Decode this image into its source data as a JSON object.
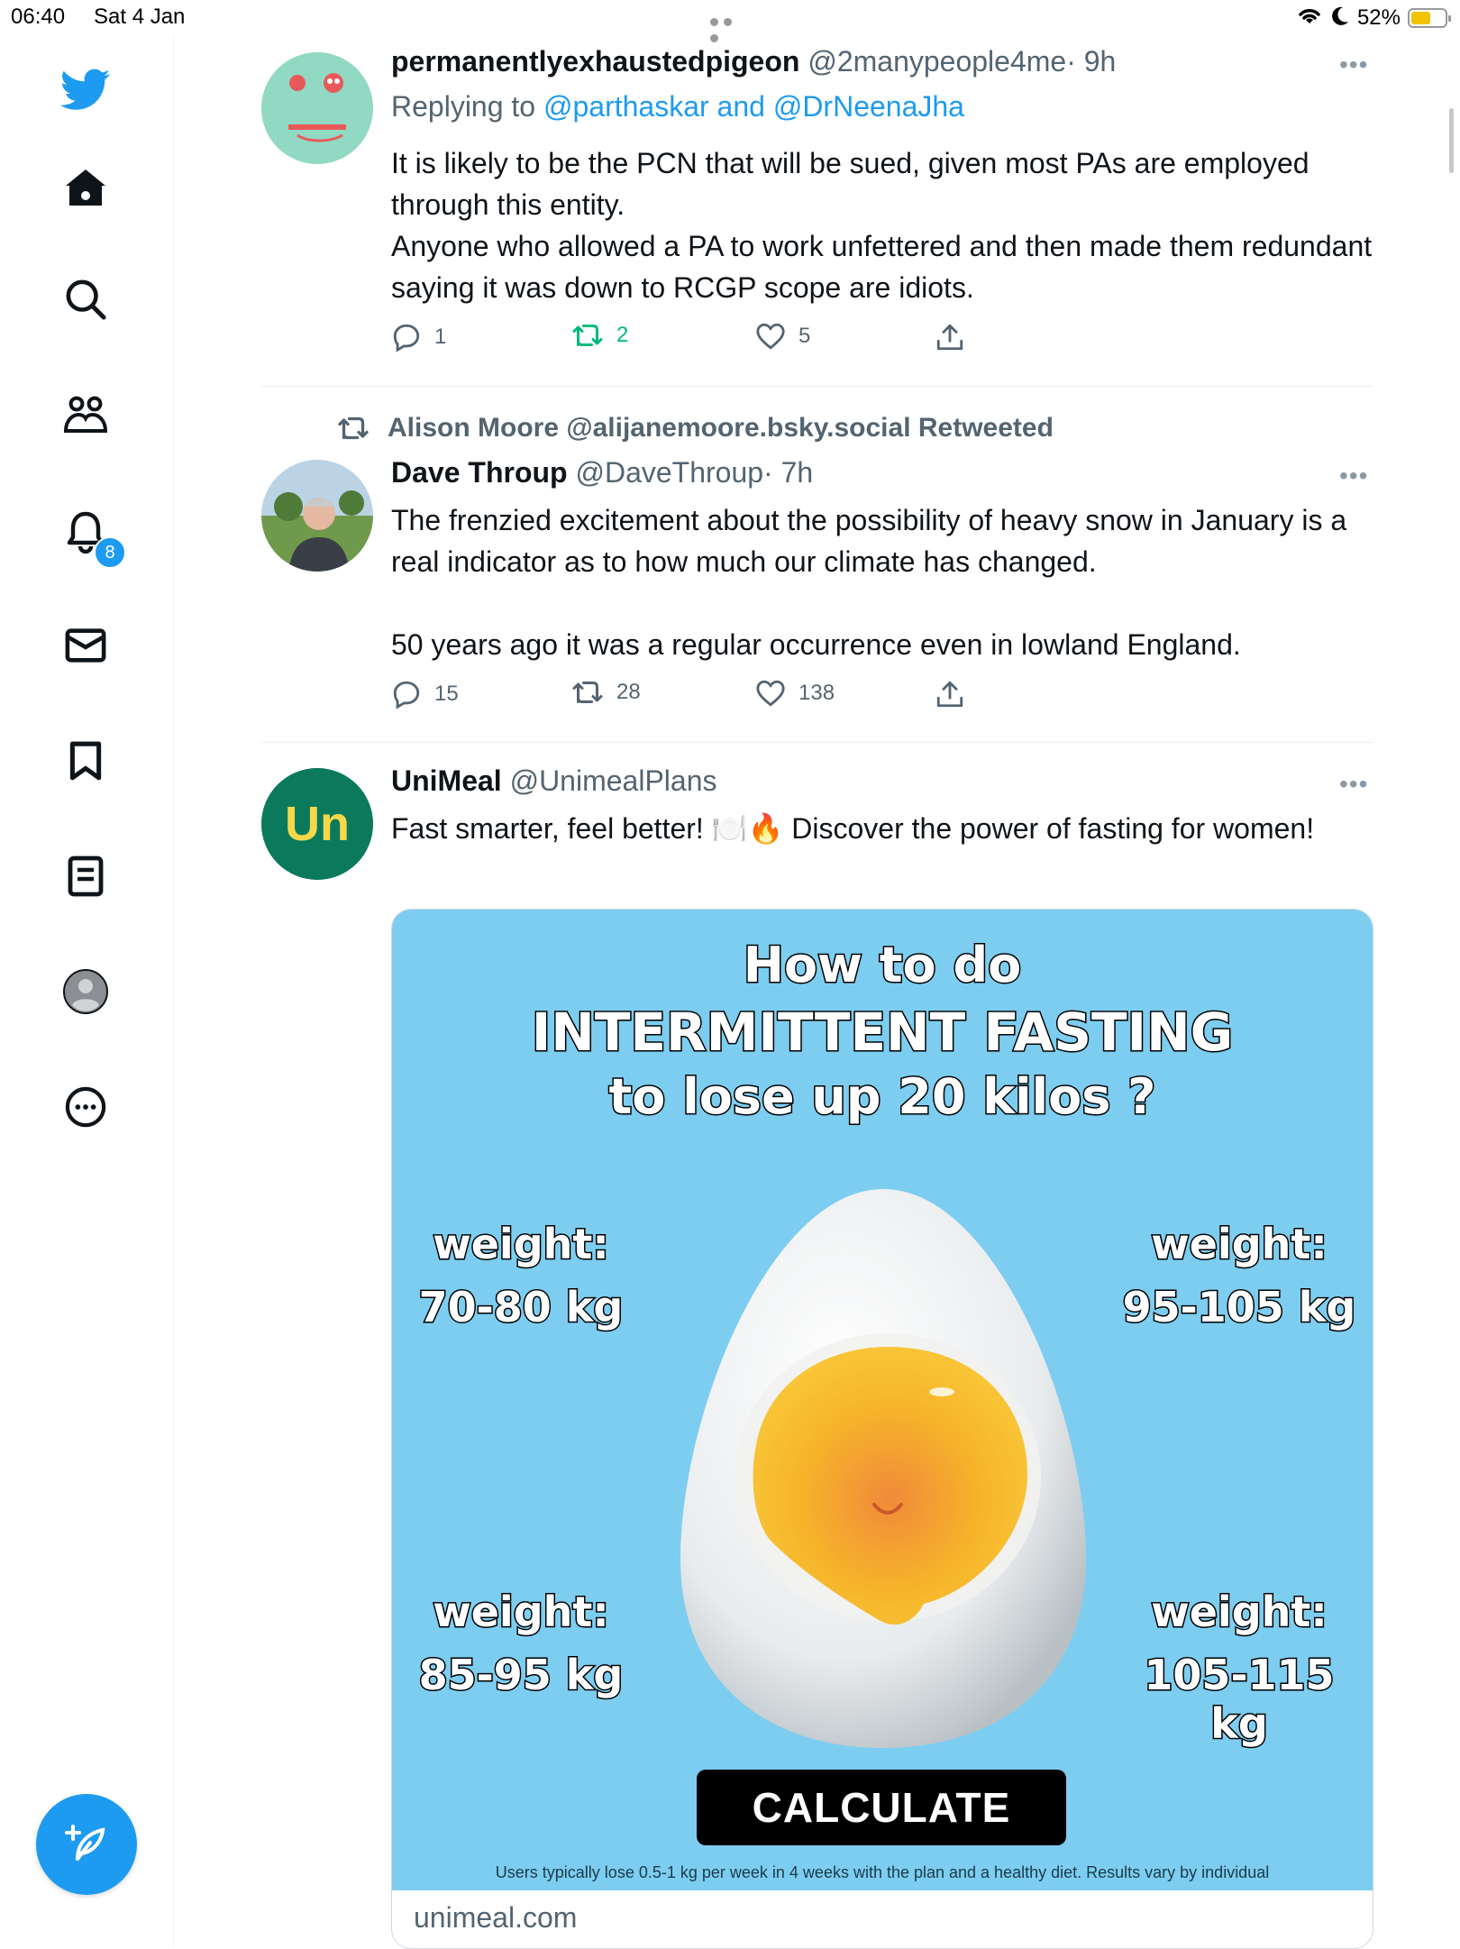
{
  "status_bar": {
    "time": "06:40",
    "date": "Sat 4 Jan",
    "battery_pct": "52%",
    "battery_level": 0.52,
    "icons": [
      "wifi-icon",
      "moon-icon",
      "battery-icon"
    ]
  },
  "sidebar": {
    "items": [
      {
        "name": "logo",
        "icon": "bird-icon"
      },
      {
        "name": "home",
        "icon": "home-icon"
      },
      {
        "name": "explore",
        "icon": "search-icon"
      },
      {
        "name": "communities",
        "icon": "people-icon"
      },
      {
        "name": "notifications",
        "icon": "bell-icon"
      },
      {
        "name": "messages",
        "icon": "envelope-icon"
      },
      {
        "name": "bookmarks",
        "icon": "bookmark-icon"
      },
      {
        "name": "lists",
        "icon": "list-icon"
      },
      {
        "name": "profile",
        "icon": "avatar-icon"
      },
      {
        "name": "more",
        "icon": "more-icon"
      }
    ],
    "notification_count": "8",
    "compose_icon": "compose-icon"
  },
  "colors": {
    "accent": "#1d9bf0",
    "retweet_green": "#00ba7c",
    "muted": "#536471",
    "ad_background": "#7dcdf0"
  },
  "tweets": [
    {
      "name": "permanentlyexhaustedpigeon",
      "handle": "@2manypeople4me",
      "time": "· 9h",
      "replying_prefix": "Replying to",
      "replying_to": "@parthaskar and @DrNeenaJha",
      "lines": [
        "It is likely to be the PCN that will be sued, given most PAs are employed through this entity.",
        "Anyone who allowed a PA to work unfettered and then made them redundant saying it was down to RCGP scope are idiots."
      ],
      "replies": "1",
      "retweets": "2",
      "likes": "5",
      "more": "•••"
    },
    {
      "retweeted_by": "Alison Moore @alijanemoore.bsky.social Retweeted",
      "name": "Dave Throup",
      "handle": "@DaveThroup",
      "time": "· 7h",
      "lines": [
        "The frenzied excitement about the possibility of heavy snow in January is a real indicator as to how much our climate has changed.",
        "50 years ago it was a regular occurrence even in lowland England."
      ],
      "replies": "15",
      "retweets": "28",
      "likes": "138",
      "more": "•••"
    },
    {
      "name": "UniMeal",
      "handle": "@UnimealPlans",
      "avatar_text": "Un",
      "text": "Fast smarter, feel better! 🍽️🔥 Discover the power of fasting for women!",
      "more": "•••",
      "card": {
        "title_line1": "How to do",
        "title_line2": "INTERMITTENT FASTING",
        "title_line3": "to lose up 20 kilos ?",
        "weights": [
          {
            "label": "weight:",
            "value": "70-80 kg"
          },
          {
            "label": "weight:",
            "value": "95-105 kg"
          },
          {
            "label": "weight:",
            "value": "85-95 kg"
          },
          {
            "label": "weight:",
            "value": "105-115 kg"
          }
        ],
        "cta": "CALCULATE",
        "disclaimer": "Users typically lose 0.5-1 kg per week in 4 weeks with the plan and a healthy diet. Results vary by individual",
        "domain": "unimeal.com"
      }
    }
  ]
}
